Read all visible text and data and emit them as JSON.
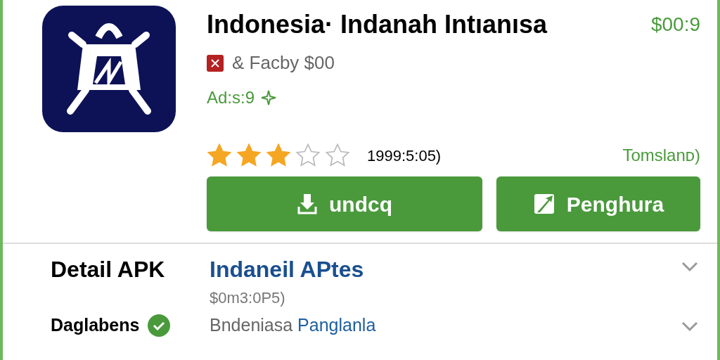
{
  "app": {
    "title": "Indonesia· Indanah Intıanısa",
    "price": "$00:9",
    "developer": "& Facby $00",
    "ads": "Ad:s:9",
    "stars": 3,
    "rating_text": "1999:5:05)",
    "side_link": "Tomslanᴅ)"
  },
  "buttons": [
    {
      "kind": "download",
      "label": "undcq"
    },
    {
      "kind": "share",
      "label": "Penghura"
    }
  ],
  "details": [
    {
      "label": "Detail APK",
      "value": "Indaneil APtes",
      "sub": "$0m3:0P5)",
      "verified": false
    },
    {
      "label": "Daglabens",
      "value": "Bndeniasa",
      "link": "Panglanla",
      "verified": true
    }
  ]
}
